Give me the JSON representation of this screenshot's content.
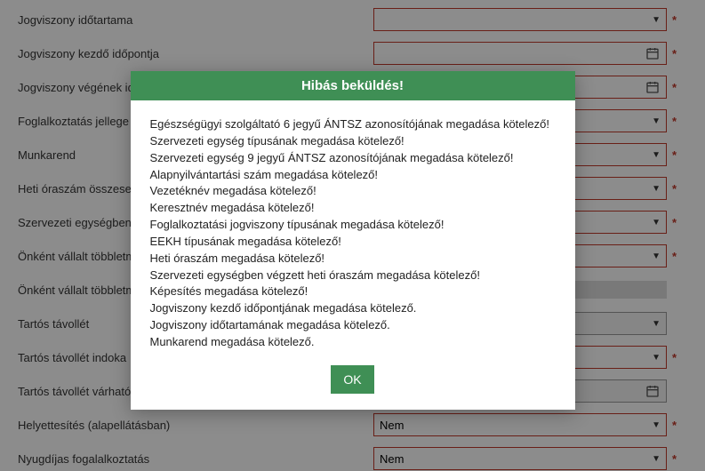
{
  "form": {
    "rows": [
      {
        "label": "Jogviszony időtartama",
        "type": "select",
        "required": true,
        "value": ""
      },
      {
        "label": "Jogviszony kezdő időpontja",
        "type": "date",
        "required": true,
        "value": ""
      },
      {
        "label": "Jogviszony végének időpontja",
        "type": "date",
        "required": true,
        "value": ""
      },
      {
        "label": "Foglalkoztatás jellege",
        "type": "select",
        "required": true,
        "value": ""
      },
      {
        "label": "Munkarend",
        "type": "select",
        "required": true,
        "value": ""
      },
      {
        "label": "Heti óraszám összesen",
        "type": "select",
        "required": true,
        "value": ""
      },
      {
        "label": "Szervezeti egységben",
        "type": "select",
        "required": true,
        "value": ""
      },
      {
        "label": "Önként vállalt többletmunka",
        "type": "select",
        "required": true,
        "value": ""
      },
      {
        "label": "Önként vállalt többletmunka",
        "type": "slider",
        "required": false,
        "value": ""
      },
      {
        "label": "Tartós távollét",
        "type": "select",
        "required": false,
        "value": ""
      },
      {
        "label": "Tartós távollét indoka",
        "type": "select",
        "required": true,
        "value": ""
      },
      {
        "label": "Tartós távollét várható vége",
        "type": "date",
        "required": false,
        "value": ""
      },
      {
        "label": "Helyettesítés (alapellátásban)",
        "type": "select",
        "required": true,
        "value": "Nem"
      },
      {
        "label": "Nyugdíjas fogalalkoztatás",
        "type": "select",
        "required": true,
        "value": "Nem"
      }
    ]
  },
  "modal": {
    "title": "Hibás beküldés!",
    "messages": [
      "Egészségügyi szolgáltató 6 jegyű ÁNTSZ azonosítójának megadása kötelező!",
      "Szervezeti egység típusának megadása kötelező!",
      "Szervezeti egység 9 jegyű ÁNTSZ azonosítójának megadása kötelező!",
      "Alapnyilvántartási szám megadása kötelező!",
      "Vezetéknév megadása kötelező!",
      "Keresztnév megadása kötelező!",
      "Foglalkoztatási jogviszony típusának megadása kötelező!",
      "EEKH típusának megadása kötelező!",
      "Heti óraszám megadása kötelező!",
      "Szervezeti egységben végzett heti óraszám megadása kötelező!",
      "Képesítés megadása kötelező!",
      "Jogviszony kezdő időpontjának megadása kötelező.",
      "Jogviszony időtartamának megadása kötelező.",
      "Munkarend megadása kötelező."
    ],
    "ok_label": "OK"
  },
  "star": "*"
}
